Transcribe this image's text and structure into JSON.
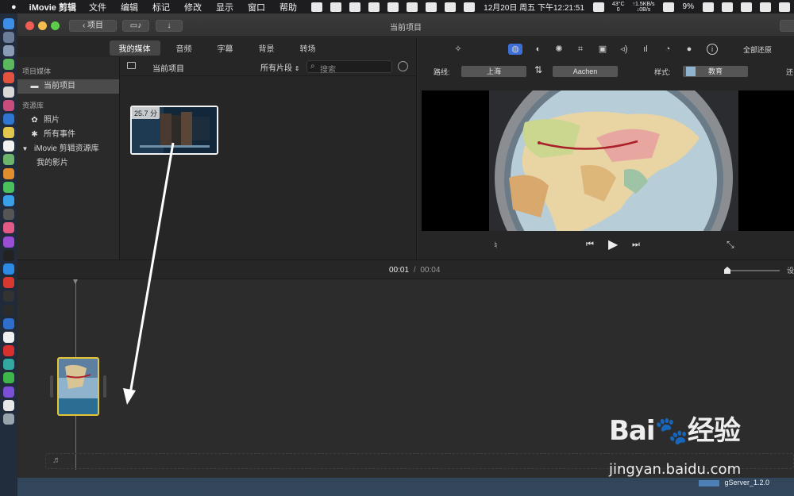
{
  "menubar": {
    "app_name": "iMovie 剪辑",
    "menus": [
      "文件",
      "编辑",
      "标记",
      "修改",
      "显示",
      "窗口",
      "帮助"
    ],
    "temp_line1": "43°C",
    "temp_line2": "0",
    "net_up": "↑1.5KB/s",
    "net_down": "↓0B/s",
    "datetime": "12月20日 周五 下午12:21:51",
    "battery": "9%"
  },
  "window": {
    "title": "当前项目",
    "back_button": "项目",
    "import_icon": "down-arrow-icon"
  },
  "browser": {
    "tabs": [
      {
        "label": "我的媒体",
        "selected": true
      },
      {
        "label": "音频",
        "selected": false
      },
      {
        "label": "字幕",
        "selected": false
      },
      {
        "label": "背景",
        "selected": false
      },
      {
        "label": "转场",
        "selected": false
      }
    ],
    "sidebar": {
      "section1": "项目媒体",
      "current_project": "当前项目",
      "section2": "资源库",
      "photos": "照片",
      "all_events": "所有事件",
      "library": "iMovie 剪辑资源库",
      "my_movies": "我的影片"
    },
    "media_header": {
      "title": "当前项目",
      "filter": "所有片段",
      "search_placeholder": "搜索"
    },
    "clip": {
      "duration": "25.7 分"
    }
  },
  "viewer": {
    "reset_all": "全部还原",
    "route_label": "路线:",
    "route_from": "上海",
    "route_to": "Aachen",
    "style_label": "样式:",
    "style_value": "教育",
    "cut_text": "还"
  },
  "timeline": {
    "current_time": "00:01",
    "separator": "/",
    "total_time": "00:04",
    "settings_cut": "设"
  },
  "watermark": {
    "logo": "Bai🐾经验",
    "url": "jingyan.baidu.com"
  },
  "taskbar": {
    "gserver": "gServer_1.2.0"
  }
}
